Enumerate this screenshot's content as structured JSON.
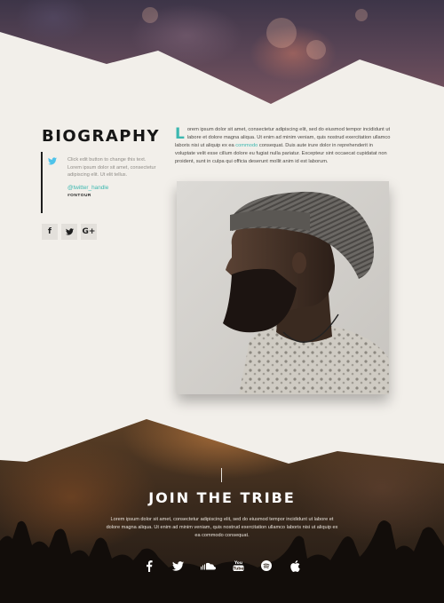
{
  "biography": {
    "title": "BIOGRAPHY",
    "tweet": {
      "icon": "twitter-icon",
      "text": "Click edit button to change this text. Lorem ipsum dolor sit amet, consectetur adipiscing elit. Ut elit tellus.",
      "handle": "@twitter_handle",
      "tag": "#ONTOUR"
    },
    "social_buttons": [
      {
        "icon": "facebook-icon",
        "label": "f"
      },
      {
        "icon": "twitter-icon",
        "label": ""
      },
      {
        "icon": "google-plus-icon",
        "label": "G+"
      }
    ],
    "dropcap": "L",
    "body_part1": "orem ipsum dolor sit amet, consectetur adipiscing elit, sed do eiusmod tempor incididunt ut labore et dolore magna aliqua. Ut enim ad minim veniam, quis nostrud exercitation ullamco laboris nisi ut aliquip ex ea ",
    "body_link": "commodo",
    "body_part2": " consequat. Duis aute irure dolor in reprehenderit in voluptate velit esse cillum dolore eu fugiat nulla pariatur. Excepteur sint occaecat cupidatat non proident, sunt in culpa qui officia deserunt mollit anim id est laborum."
  },
  "tribe": {
    "title": "JOIN THE TRIBE",
    "body": "Lorem ipsum dolor sit amet, consectetur adipiscing elit, sed do eiusmod tempor incididunt ut labore et dolore magna aliqua. Ut enim ad minim veniam, quis nostrud exercitation ullamco laboris nisi ut aliquip ex ea commodo consequat.",
    "icons": [
      "facebook-icon",
      "twitter-icon",
      "soundcloud-icon",
      "youtube-icon",
      "spotify-icon",
      "apple-icon"
    ],
    "youtube_label": "You Tube"
  },
  "colors": {
    "accent": "#3cb8b0",
    "background": "#f2efea",
    "heading": "#161616"
  }
}
